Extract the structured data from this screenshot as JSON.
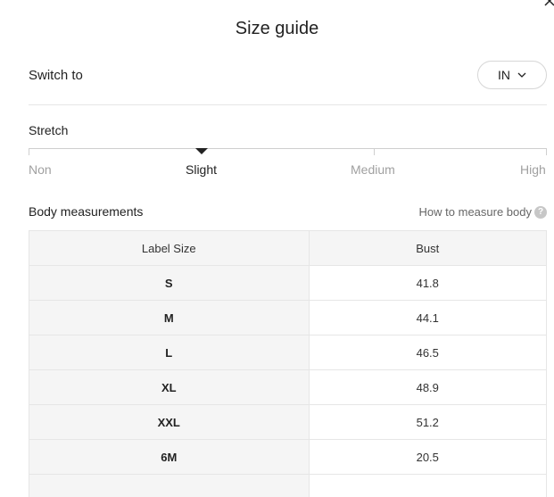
{
  "dialog": {
    "title": "Size guide",
    "close_icon": "close-icon"
  },
  "switch": {
    "label": "Switch to",
    "unit_value": "IN",
    "chevron_icon": "chevron-down-icon"
  },
  "stretch": {
    "label": "Stretch",
    "options": [
      "Non",
      "Slight",
      "Medium",
      "High"
    ],
    "selected": "Slight"
  },
  "body": {
    "title": "Body measurements",
    "how_link": "How to measure body",
    "help_icon_glyph": "?"
  },
  "table": {
    "headers": [
      "Label Size",
      "Bust"
    ],
    "rows": [
      {
        "size": "S",
        "bust": "41.8"
      },
      {
        "size": "M",
        "bust": "44.1"
      },
      {
        "size": "L",
        "bust": "46.5"
      },
      {
        "size": "XL",
        "bust": "48.9"
      },
      {
        "size": "XXL",
        "bust": "51.2"
      },
      {
        "size": "6M",
        "bust": "20.5"
      },
      {
        "size": "",
        "bust": ""
      }
    ]
  }
}
